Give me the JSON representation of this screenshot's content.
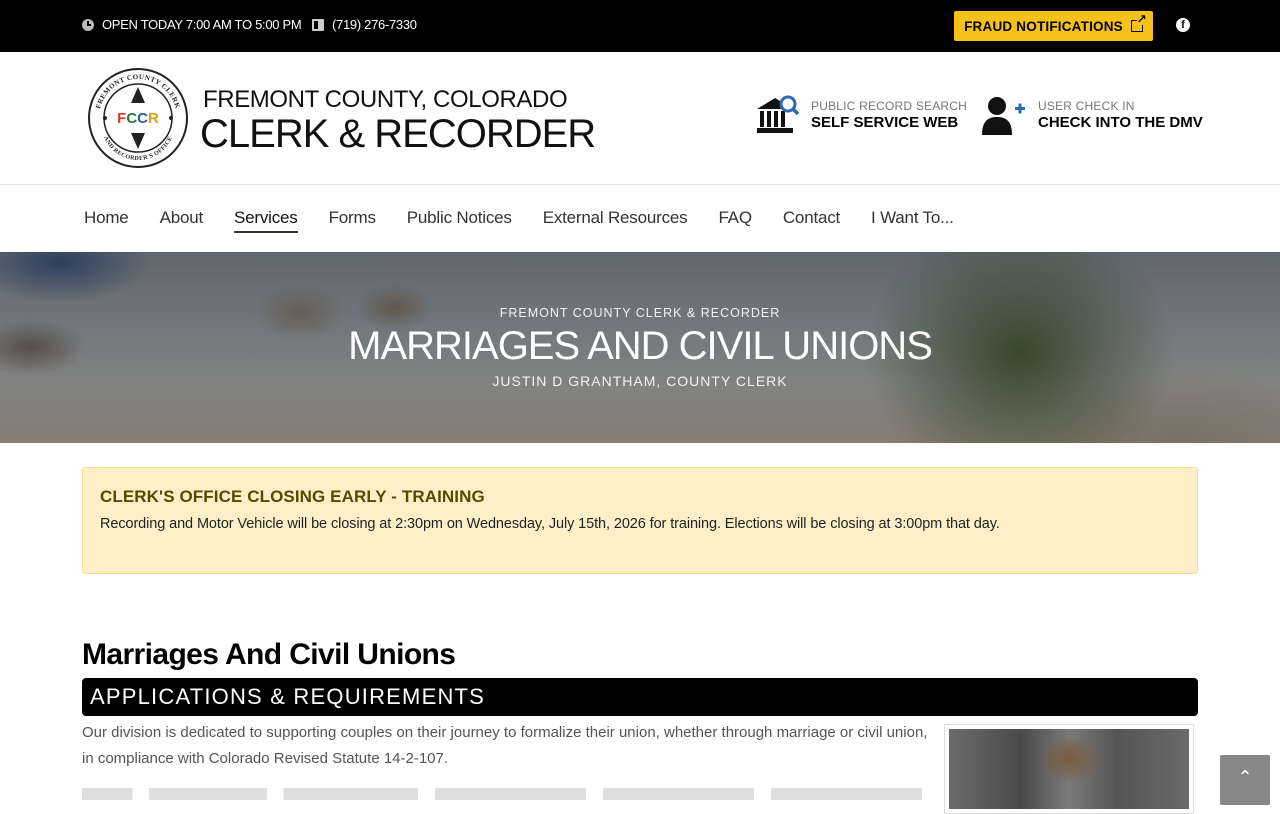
{
  "topbar": {
    "hours": "OPEN TODAY 7:00 AM TO 5:00 PM",
    "phone": "(719) 276-7330",
    "fraud_button": "FRAUD NOTIFICATIONS",
    "accent_color": "#f6c21a"
  },
  "header": {
    "seal_text_top": "FREMONT COUNTY CLERK",
    "seal_text_bottom": "AND RECORDER'S OFFICE",
    "seal_monogram": "FCCR",
    "org_line1": "FREMONT COUNTY, COLORADO",
    "org_line2": "CLERK & RECORDER",
    "quick_links": [
      {
        "small": "PUBLIC RECORD SEARCH",
        "big": "SELF SERVICE WEB",
        "icon": "bank-search-icon"
      },
      {
        "small": "USER CHECK IN",
        "big": "CHECK INTO THE DMV",
        "icon": "user-plus-icon"
      }
    ]
  },
  "nav": {
    "items": [
      "Home",
      "About",
      "Services",
      "Forms",
      "Public Notices",
      "External Resources",
      "FAQ",
      "Contact",
      "I Want To..."
    ],
    "active": "Services"
  },
  "hero": {
    "kicker": "FREMONT COUNTY CLERK & RECORDER",
    "title": "MARRIAGES AND CIVIL UNIONS",
    "subtitle": "JUSTIN D GRANTHAM, COUNTY CLERK"
  },
  "alert": {
    "heading": "CLERK'S OFFICE CLOSING EARLY - TRAINING",
    "body": "Recording and Motor Vehicle will be closing at 2:30pm on Wednesday, July 15th, 2026 for training.  Elections will be closing at 3:00pm that day."
  },
  "content": {
    "page_title": "Marriages And Civil Unions",
    "section_heading": "APPLICATIONS & REQUIREMENTS",
    "intro": "Our division is dedicated to supporting couples on their journey to formalize their union, whether through marriage or civil union, in compliance with Colorado Revised Statute 14-2-107."
  },
  "back_to_top": "⌃"
}
